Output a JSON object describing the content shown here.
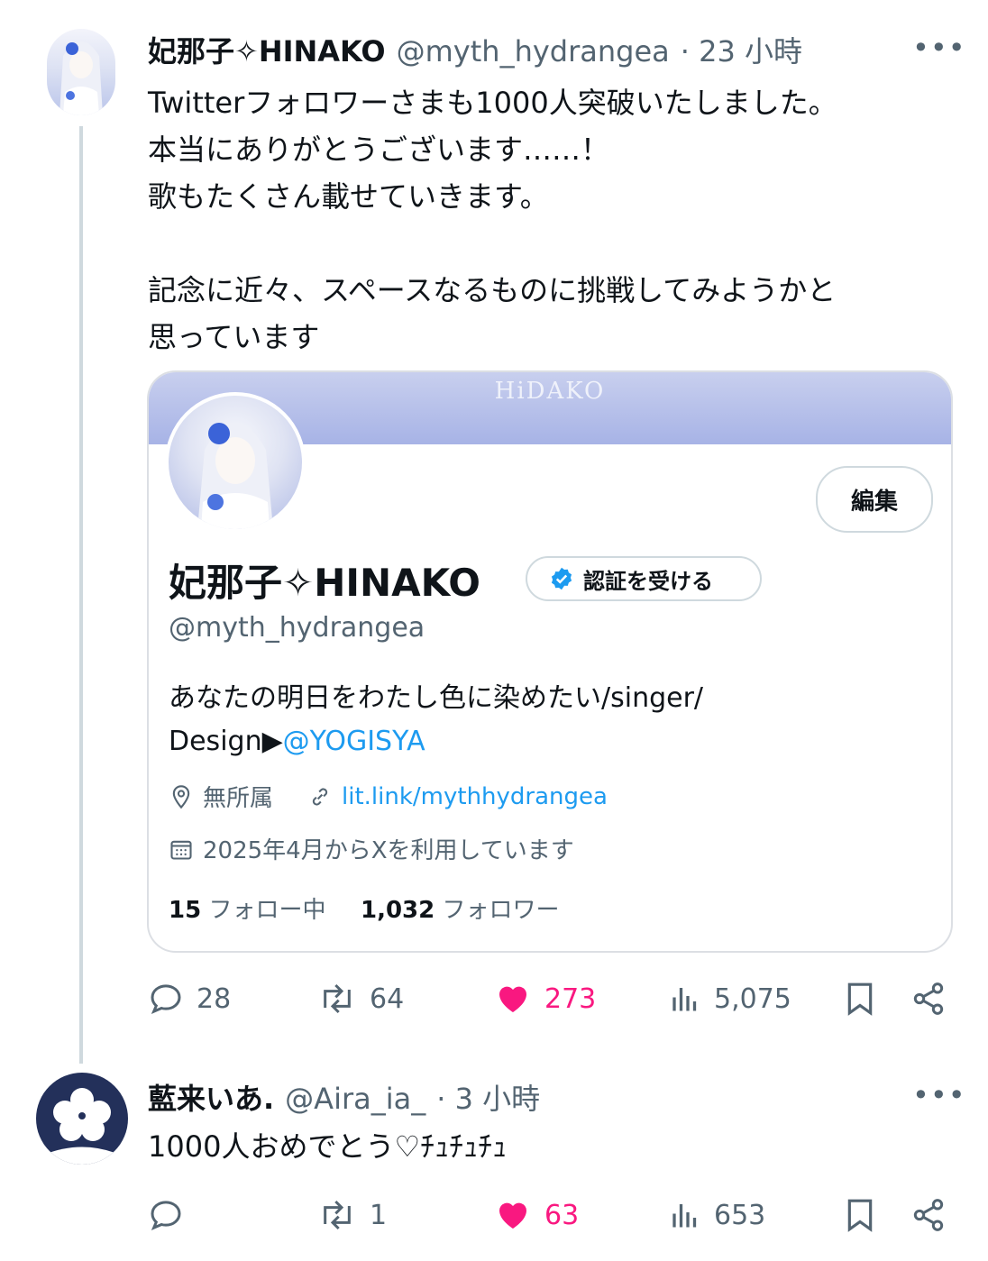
{
  "tweet": {
    "name": "妃那子✧HINAKO",
    "handle": "@myth_hydrangea",
    "time": "· 23 小時",
    "more": "•••",
    "text": "Twitterフォロワーさまも1000人突破いたしました。\n本当にありがとうございます……！\n歌もたくさん載せていきます。\n\n記念に近々、スペースなるものに挑戦してみようかと\n思っています",
    "card": {
      "banner_logo": "HiDAKO",
      "edit_label": "編集",
      "name": "妃那子✧HINAKO",
      "verify_label": "認証を受ける",
      "handle": "@myth_hydrangea",
      "bio_line1": "あなたの明日をわたし色に染めたい/singer/",
      "bio_design": "Design▶",
      "bio_link": "@YOGISYA",
      "location": "無所属",
      "url": "lit.link/mythhydrangea",
      "joined": "2025年4月からXを利用しています",
      "following_count": "15",
      "following_label": "フォロー中",
      "followers_count": "1,032",
      "followers_label": "フォロワー"
    },
    "actions": {
      "replies": "28",
      "retweets": "64",
      "likes": "273",
      "views": "5,075"
    }
  },
  "reply": {
    "name": "藍来いあ.",
    "handle": "@Aira_ia_",
    "time": "· 3 小時",
    "more": "•••",
    "text": "1000人おめでとう♡ﾁｭﾁｭﾁｭ",
    "actions": {
      "replies": "",
      "retweets": "1",
      "likes": "63",
      "views": "653"
    }
  },
  "colors": {
    "like": "#f91880",
    "link": "#1d9bf0",
    "secondary_text": "#536471",
    "verified": "#1d9bf0",
    "banner": "#a7b3e6"
  },
  "icons": [
    "reply-icon",
    "retweet-icon",
    "heart-icon",
    "views-icon",
    "bookmark-icon",
    "share-icon",
    "location-icon",
    "link-icon",
    "calendar-icon",
    "verified-badge-icon"
  ]
}
